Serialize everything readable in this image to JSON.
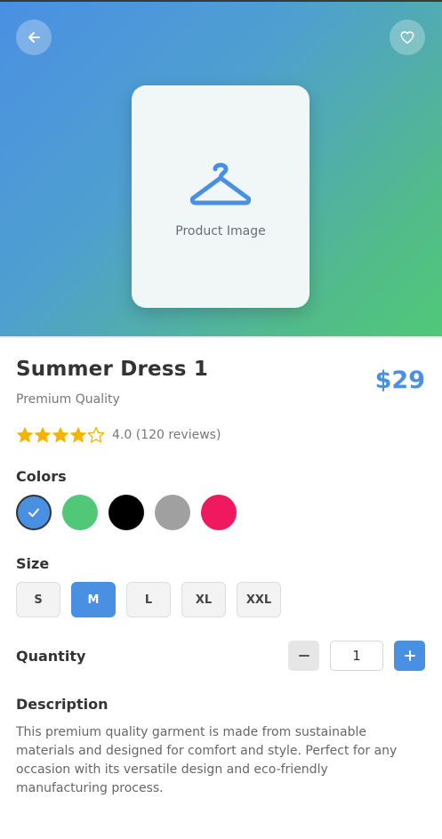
{
  "hero": {
    "placeholder_label": "Product Image",
    "back_icon": "arrow-left-icon",
    "favorite_icon": "heart-icon",
    "product_icon": "hanger-icon",
    "gradient_start": "#4a90e2",
    "gradient_end": "#50c878"
  },
  "product": {
    "title": "Summer Dress 1",
    "subtitle": "Premium Quality",
    "price": "$29",
    "rating_value": 4.0,
    "rating_max": 5,
    "rating_text": "4.0 (120 reviews)"
  },
  "colors": {
    "label": "Colors",
    "swatches": [
      {
        "name": "blue",
        "hex": "#4a90e2",
        "selected": true
      },
      {
        "name": "green",
        "hex": "#50c878",
        "selected": false
      },
      {
        "name": "black",
        "hex": "#000000",
        "selected": false
      },
      {
        "name": "gray",
        "hex": "#a0a0a0",
        "selected": false
      },
      {
        "name": "pink",
        "hex": "#f0195f",
        "selected": false
      }
    ]
  },
  "sizes": {
    "label": "Size",
    "options": [
      "S",
      "M",
      "L",
      "XL",
      "XXL"
    ],
    "selected": "M"
  },
  "quantity": {
    "label": "Quantity",
    "value": "1"
  },
  "description": {
    "label": "Description",
    "text": "This premium quality garment is made from sustainable materials and designed for comfort and style. Perfect for any occasion with its versatile design and eco-friendly manufacturing process."
  },
  "theme": {
    "accent": "#4a90e2",
    "star": "#f5b301"
  }
}
